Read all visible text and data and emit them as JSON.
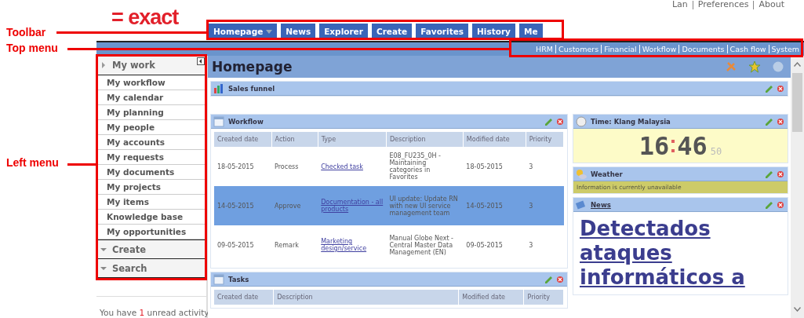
{
  "header": {
    "logo": "= exact",
    "links": [
      "Lan",
      "Preferences",
      "About"
    ]
  },
  "toolbar": {
    "tabs": [
      {
        "label": "Homepage",
        "dropdown": true
      },
      {
        "label": "News",
        "dropdown": false
      },
      {
        "label": "Explorer",
        "dropdown": false
      },
      {
        "label": "Create",
        "dropdown": false
      },
      {
        "label": "Favorites",
        "dropdown": false
      },
      {
        "label": "History",
        "dropdown": false
      },
      {
        "label": "Me",
        "dropdown": false
      }
    ]
  },
  "top_menu": {
    "items": [
      "HRM",
      "Customers",
      "Financial",
      "Workflow",
      "Documents",
      "Cash flow",
      "System"
    ]
  },
  "left_menu": {
    "sections": [
      {
        "title": "My work",
        "expanded": true,
        "items": [
          "My workflow",
          "My calendar",
          "My planning",
          "My people",
          "My accounts",
          "My requests",
          "My documents",
          "My projects",
          "My items",
          "Knowledge base",
          "My opportunities"
        ]
      },
      {
        "title": "Create",
        "expanded": false
      },
      {
        "title": "Search",
        "expanded": false
      }
    ],
    "activity": {
      "before": "You have",
      "count": "1",
      "after": "unread activity"
    }
  },
  "page": {
    "title": "Homepage"
  },
  "sales_funnel": {
    "title": "Sales funnel"
  },
  "workflow": {
    "title": "Workflow",
    "columns": [
      "Created date",
      "Action",
      "Type",
      "Description",
      "Modified date",
      "Priority"
    ],
    "rows": [
      {
        "selected": false,
        "cells": [
          "18-05-2015",
          "Process",
          "Checked task",
          "E08_FU235_0H - Maintaining categories in Favorites",
          "18-05-2015",
          "3"
        ]
      },
      {
        "selected": true,
        "cells": [
          "14-05-2015",
          "Approve",
          "Documentation - all products",
          "UI update: Update RN with new UI service management team",
          "14-05-2015",
          "3"
        ]
      },
      {
        "selected": false,
        "cells": [
          "09-05-2015",
          "Remark",
          "Marketing design/service",
          "Manual Globe Next - Central Master Data Management (EN)",
          "09-05-2015",
          "3"
        ]
      }
    ]
  },
  "tasks": {
    "title": "Tasks",
    "columns": [
      "Created date",
      "Description",
      "Modified date",
      "Priority"
    ]
  },
  "time": {
    "title": "Time: Klang Malaysia",
    "hours": "16",
    "minutes": "46",
    "seconds": "50"
  },
  "weather": {
    "title": "Weather",
    "message": "Information is currently unavailable"
  },
  "news": {
    "title": "News",
    "headline": "Detectados ataques informáticos a"
  },
  "annotations": [
    {
      "label": "Toolbar"
    },
    {
      "label": "Top menu"
    },
    {
      "label": "Left menu"
    }
  ]
}
